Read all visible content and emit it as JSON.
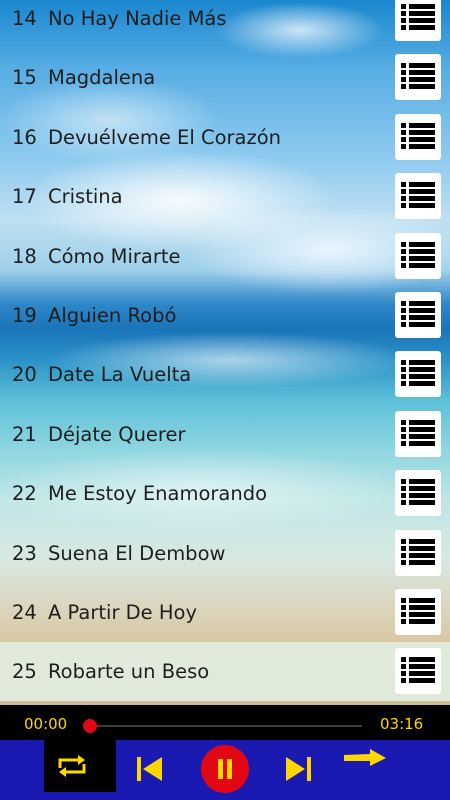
{
  "colors": {
    "accent": "#ffd700",
    "control_bar": "#1a1ab3",
    "player_bg": "#000000",
    "seek_thumb": "#e30613",
    "pause_circle": "#e30613",
    "active_row": "#e1eee1"
  },
  "playlist": [
    {
      "num": "14",
      "title": "No Hay Nadie Más",
      "icon": "menu-list-icon"
    },
    {
      "num": "15",
      "title": "Magdalena",
      "icon": "menu-list-icon"
    },
    {
      "num": "16",
      "title": "Devuélveme El Corazón",
      "icon": "menu-list-icon"
    },
    {
      "num": "17",
      "title": "Cristina",
      "icon": "menu-list-icon"
    },
    {
      "num": "18",
      "title": "Cómo Mirarte",
      "icon": "menu-list-icon"
    },
    {
      "num": "19",
      "title": "Alguien Robó",
      "icon": "menu-list-icon"
    },
    {
      "num": "20",
      "title": "Date La Vuelta",
      "icon": "menu-list-icon"
    },
    {
      "num": "21",
      "title": "Déjate Querer",
      "icon": "menu-list-icon"
    },
    {
      "num": "22",
      "title": "Me Estoy Enamorando",
      "icon": "menu-list-icon"
    },
    {
      "num": "23",
      "title": "Suena El Dembow",
      "icon": "menu-list-icon"
    },
    {
      "num": "24",
      "title": "A Partir De Hoy",
      "icon": "menu-list-icon"
    },
    {
      "num": "25",
      "title": "Robarte un Beso",
      "icon": "menu-list-icon",
      "active": true
    }
  ],
  "player": {
    "elapsed": "00:00",
    "duration": "03:16",
    "progress_fraction": 0.0,
    "icons": {
      "repeat": "repeat-icon",
      "previous": "skip-previous-icon",
      "pause": "pause-icon",
      "next": "skip-next-icon",
      "forward": "arrow-right-icon"
    }
  }
}
